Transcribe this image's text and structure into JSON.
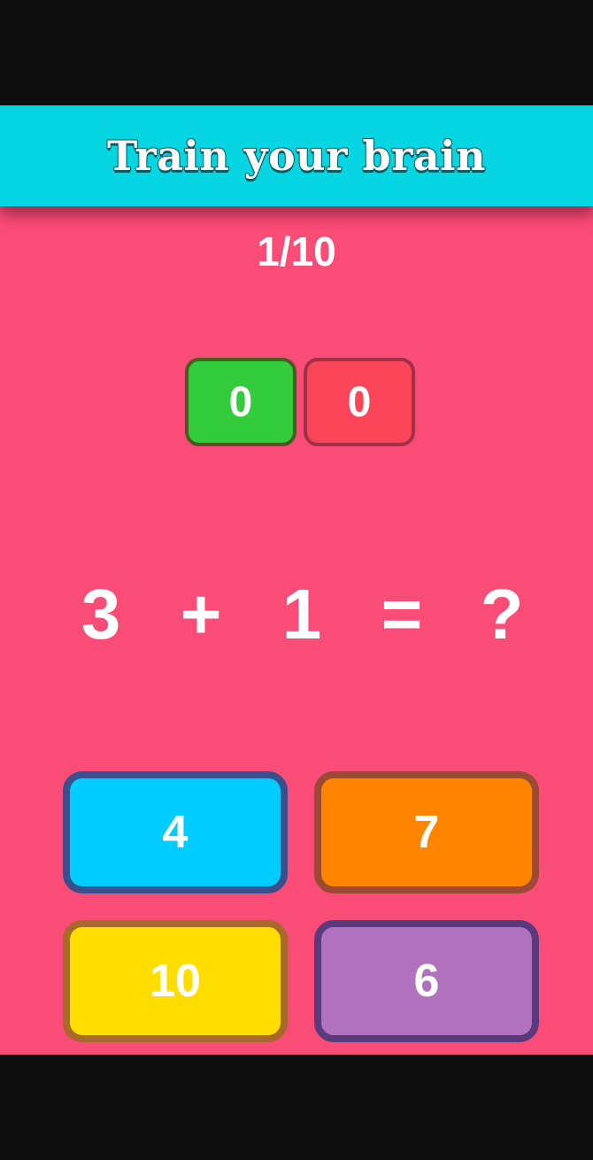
{
  "header": {
    "title": "Train your brain"
  },
  "progress": {
    "text": "1/10"
  },
  "scores": {
    "correct": "0",
    "wrong": "0"
  },
  "equation": {
    "left_operand": "3",
    "operator": "+",
    "right_operand": "1",
    "equals": "=",
    "unknown": "?"
  },
  "answers": [
    {
      "label": "4"
    },
    {
      "label": "7"
    },
    {
      "label": "10"
    },
    {
      "label": "6"
    }
  ],
  "colors": {
    "background": "#f94c77",
    "header": "#05d6e2",
    "correct_badge": "#33cc3d",
    "wrong_badge": "#fb4559",
    "answer_blue": "#00ccff",
    "answer_orange": "#ff8400",
    "answer_yellow": "#ffdd00",
    "answer_purple": "#b172bd"
  }
}
